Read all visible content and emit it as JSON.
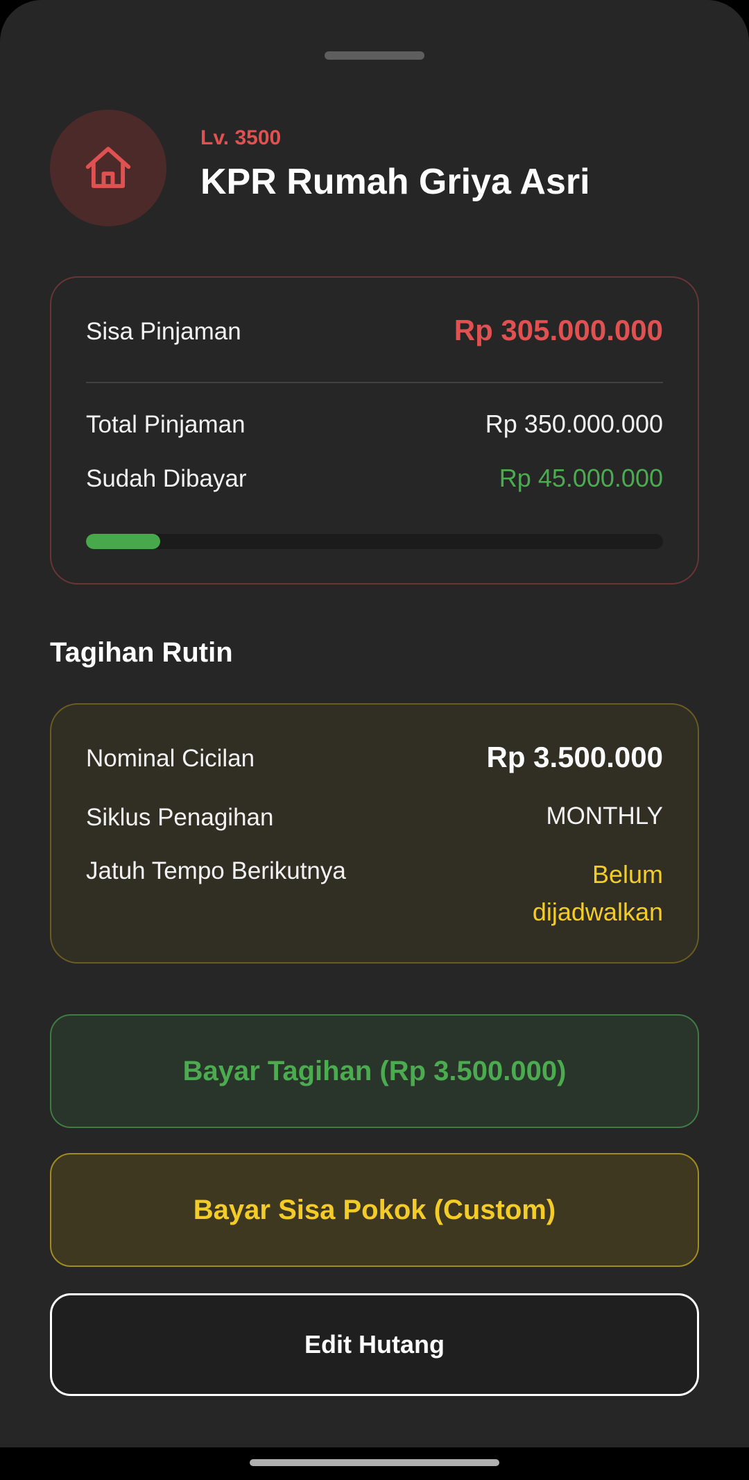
{
  "header": {
    "level": "Lv. 3500",
    "title": "KPR Rumah Griya Asri",
    "icon": "house-icon"
  },
  "loan": {
    "remaining_label": "Sisa Pinjaman",
    "remaining_value": "Rp 305.000.000",
    "total_label": "Total Pinjaman",
    "total_value": "Rp 350.000.000",
    "paid_label": "Sudah Dibayar",
    "paid_value": "Rp 45.000.000",
    "progress_percent": 12.86
  },
  "billing": {
    "section_title": "Tagihan Rutin",
    "installment_label": "Nominal Cicilan",
    "installment_value": "Rp 3.500.000",
    "cycle_label": "Siklus Penagihan",
    "cycle_value": "MONTHLY",
    "due_label": "Jatuh Tempo Berikutnya",
    "due_value_line1": "Belum",
    "due_value_line2": "dijadwalkan"
  },
  "actions": {
    "pay_bill": "Bayar Tagihan (Rp 3.500.000)",
    "pay_principal": "Bayar Sisa Pokok (Custom)",
    "edit_debt": "Edit Hutang"
  },
  "colors": {
    "accent_red": "#e05151",
    "accent_green": "#4cab50",
    "accent_yellow": "#f3cc27",
    "background": "#262626"
  }
}
